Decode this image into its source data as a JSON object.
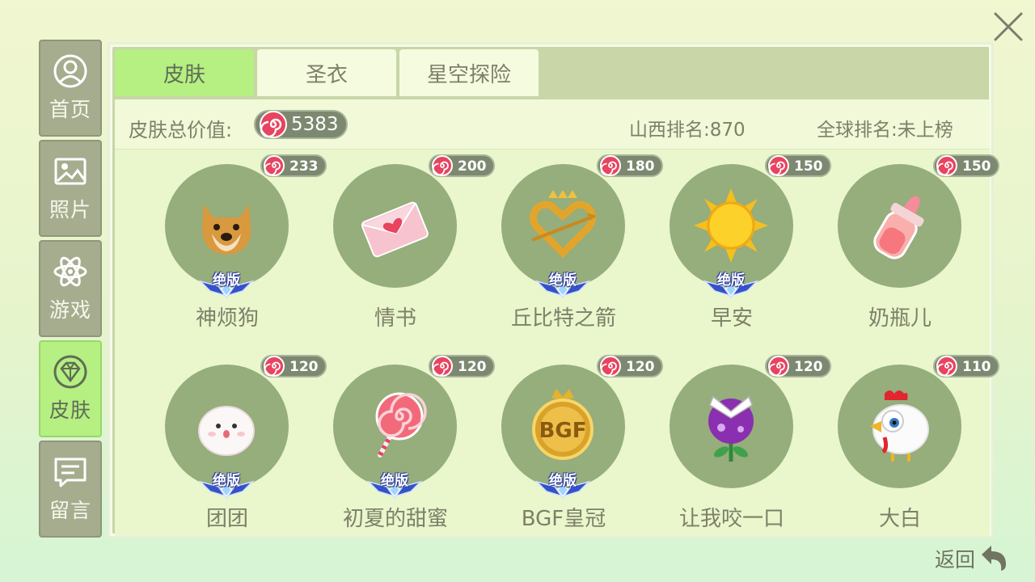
{
  "sidebar": {
    "items": [
      {
        "label": "首页",
        "icon": "profile-icon",
        "active": false
      },
      {
        "label": "照片",
        "icon": "image-icon",
        "active": false
      },
      {
        "label": "游戏",
        "icon": "atom-icon",
        "active": false
      },
      {
        "label": "皮肤",
        "icon": "diamond-icon",
        "active": true
      },
      {
        "label": "留言",
        "icon": "message-icon",
        "active": false
      }
    ]
  },
  "tabs": [
    {
      "label": "皮肤",
      "active": true
    },
    {
      "label": "圣衣",
      "active": false
    },
    {
      "label": "星空探险",
      "active": false
    }
  ],
  "summary": {
    "total_label": "皮肤总价值:",
    "total_value": "5383",
    "province_rank": "山西排名:870",
    "global_rank": "全球排名:未上榜"
  },
  "badge_text": "绝版",
  "skins": [
    {
      "name": "神烦狗",
      "price": "233",
      "limited": true,
      "icon": "doge-icon"
    },
    {
      "name": "情书",
      "price": "200",
      "limited": false,
      "icon": "love-letter-icon"
    },
    {
      "name": "丘比特之箭",
      "price": "180",
      "limited": true,
      "icon": "cupid-heart-icon"
    },
    {
      "name": "早安",
      "price": "150",
      "limited": true,
      "icon": "sun-icon"
    },
    {
      "name": "奶瓶儿",
      "price": "150",
      "limited": false,
      "icon": "baby-bottle-icon"
    },
    {
      "name": "团团",
      "price": "120",
      "limited": true,
      "icon": "white-blob-icon"
    },
    {
      "name": "初夏的甜蜜",
      "price": "120",
      "limited": true,
      "icon": "lollipop-icon"
    },
    {
      "name": "BGF皇冠",
      "price": "120",
      "limited": true,
      "icon": "bgf-crown-icon"
    },
    {
      "name": "让我咬一口",
      "price": "120",
      "limited": false,
      "icon": "piranha-plant-icon"
    },
    {
      "name": "大白",
      "price": "110",
      "limited": false,
      "icon": "chicken-icon"
    }
  ],
  "back_label": "返回",
  "colors": {
    "active_green": "#b6ef82",
    "sidebar_gray": "#a6ad8f",
    "circle_green": "#96ad7c",
    "pill_dark": "#7c8870",
    "candy_pink": "#e8435f"
  }
}
